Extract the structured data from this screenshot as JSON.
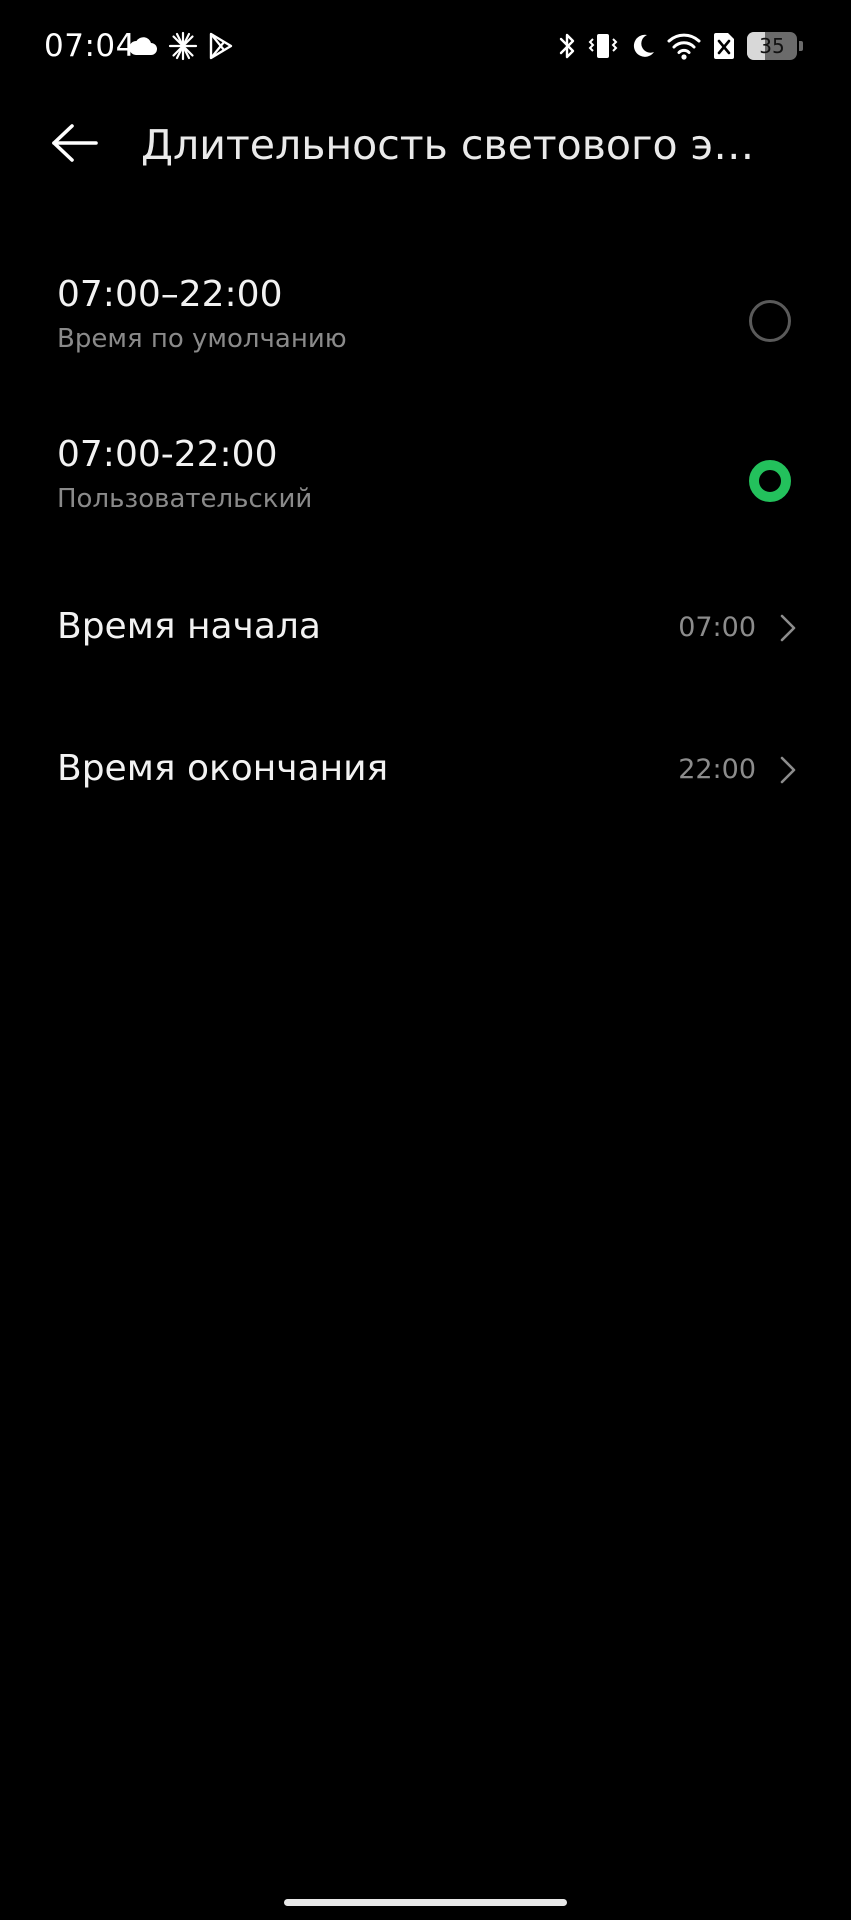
{
  "status_bar": {
    "time": "07:04",
    "left_icons": [
      "cloud-icon",
      "sparkle-icon",
      "play-store-icon"
    ],
    "right_icons": [
      "bluetooth-icon",
      "vibrate-icon",
      "moon-icon",
      "wifi-icon",
      "no-sim-icon",
      "battery-icon"
    ],
    "battery_level": "35"
  },
  "header": {
    "title": "Длительность светового эффекта"
  },
  "options": [
    {
      "title": "07:00–22:00",
      "subtitle": "Время по умолчанию",
      "selected": false
    },
    {
      "title": "07:00-22:00",
      "subtitle": "Пользовательский",
      "selected": true
    }
  ],
  "settings": [
    {
      "label": "Время начала",
      "value": "07:00"
    },
    {
      "label": "Время окончания",
      "value": "22:00"
    }
  ],
  "colors": {
    "background": "#000000",
    "accent": "#23c15c",
    "text_primary": "#f2f2f2",
    "text_secondary": "#8a8a8a"
  }
}
